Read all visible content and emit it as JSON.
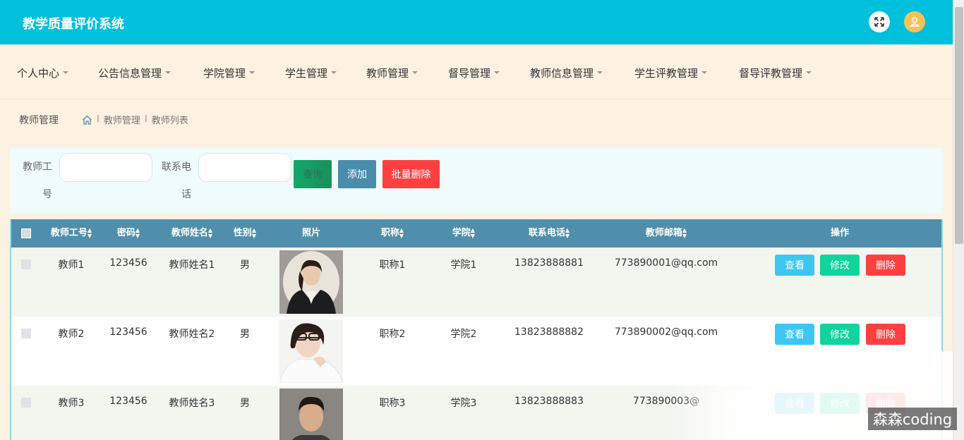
{
  "app": {
    "title": "教学质量评价系统"
  },
  "topbar": {
    "fullscreen_icon": "expand-icon",
    "user_icon": "user-icon"
  },
  "nav": {
    "items": [
      {
        "label": "个人中心"
      },
      {
        "label": "公告信息管理"
      },
      {
        "label": "学院管理"
      },
      {
        "label": "学生管理"
      },
      {
        "label": "教师管理"
      },
      {
        "label": "督导管理"
      },
      {
        "label": "教师信息管理"
      },
      {
        "label": "学生评教管理"
      },
      {
        "label": "督导评教管理"
      }
    ]
  },
  "breadcrumb": {
    "page_title": "教师管理",
    "items": [
      "教师管理",
      "教师列表"
    ],
    "separator": "I"
  },
  "search": {
    "teacher_no_label_1": "教师工",
    "teacher_no_label_2": "号",
    "phone_label_1": "联系电",
    "phone_label_2": "话",
    "teacher_no_value": "",
    "phone_value": "",
    "query_label": "查询",
    "add_label": "添加",
    "batch_delete_label": "批量删除"
  },
  "table": {
    "headers": {
      "teacher_no": "教师工号",
      "password": "密码",
      "name": "教师姓名",
      "gender": "性别",
      "photo": "照片",
      "title": "职称",
      "college": "学院",
      "phone": "联系电话",
      "email": "教师邮箱",
      "actions": "操作"
    },
    "actions": {
      "view": "查看",
      "edit": "修改",
      "delete": "删除"
    },
    "rows": [
      {
        "teacher_no": "教师1",
        "password": "123456",
        "name": "教师姓名1",
        "gender": "男",
        "title": "职称1",
        "college": "学院1",
        "phone": "13823888881",
        "email": "773890001@qq.com"
      },
      {
        "teacher_no": "教师2",
        "password": "123456",
        "name": "教师姓名2",
        "gender": "男",
        "title": "职称2",
        "college": "学院2",
        "phone": "13823888882",
        "email": "773890002@qq.com"
      },
      {
        "teacher_no": "教师3",
        "password": "123456",
        "name": "教师姓名3",
        "gender": "男",
        "title": "职称3",
        "college": "学院3",
        "phone": "13823888883",
        "email": "773890003@"
      }
    ]
  },
  "watermark": "森森coding",
  "colors": {
    "topbar": "#00c0dc",
    "nav_bg": "#fdf1e1",
    "table_header": "#4f8fab",
    "query_btn": "#16a06a",
    "add_btn": "#4a8cab",
    "batch_delete_btn": "#ff4040",
    "view_btn": "#3ec6f2",
    "edit_btn": "#10d49b",
    "delete_btn": "#ff4040"
  }
}
